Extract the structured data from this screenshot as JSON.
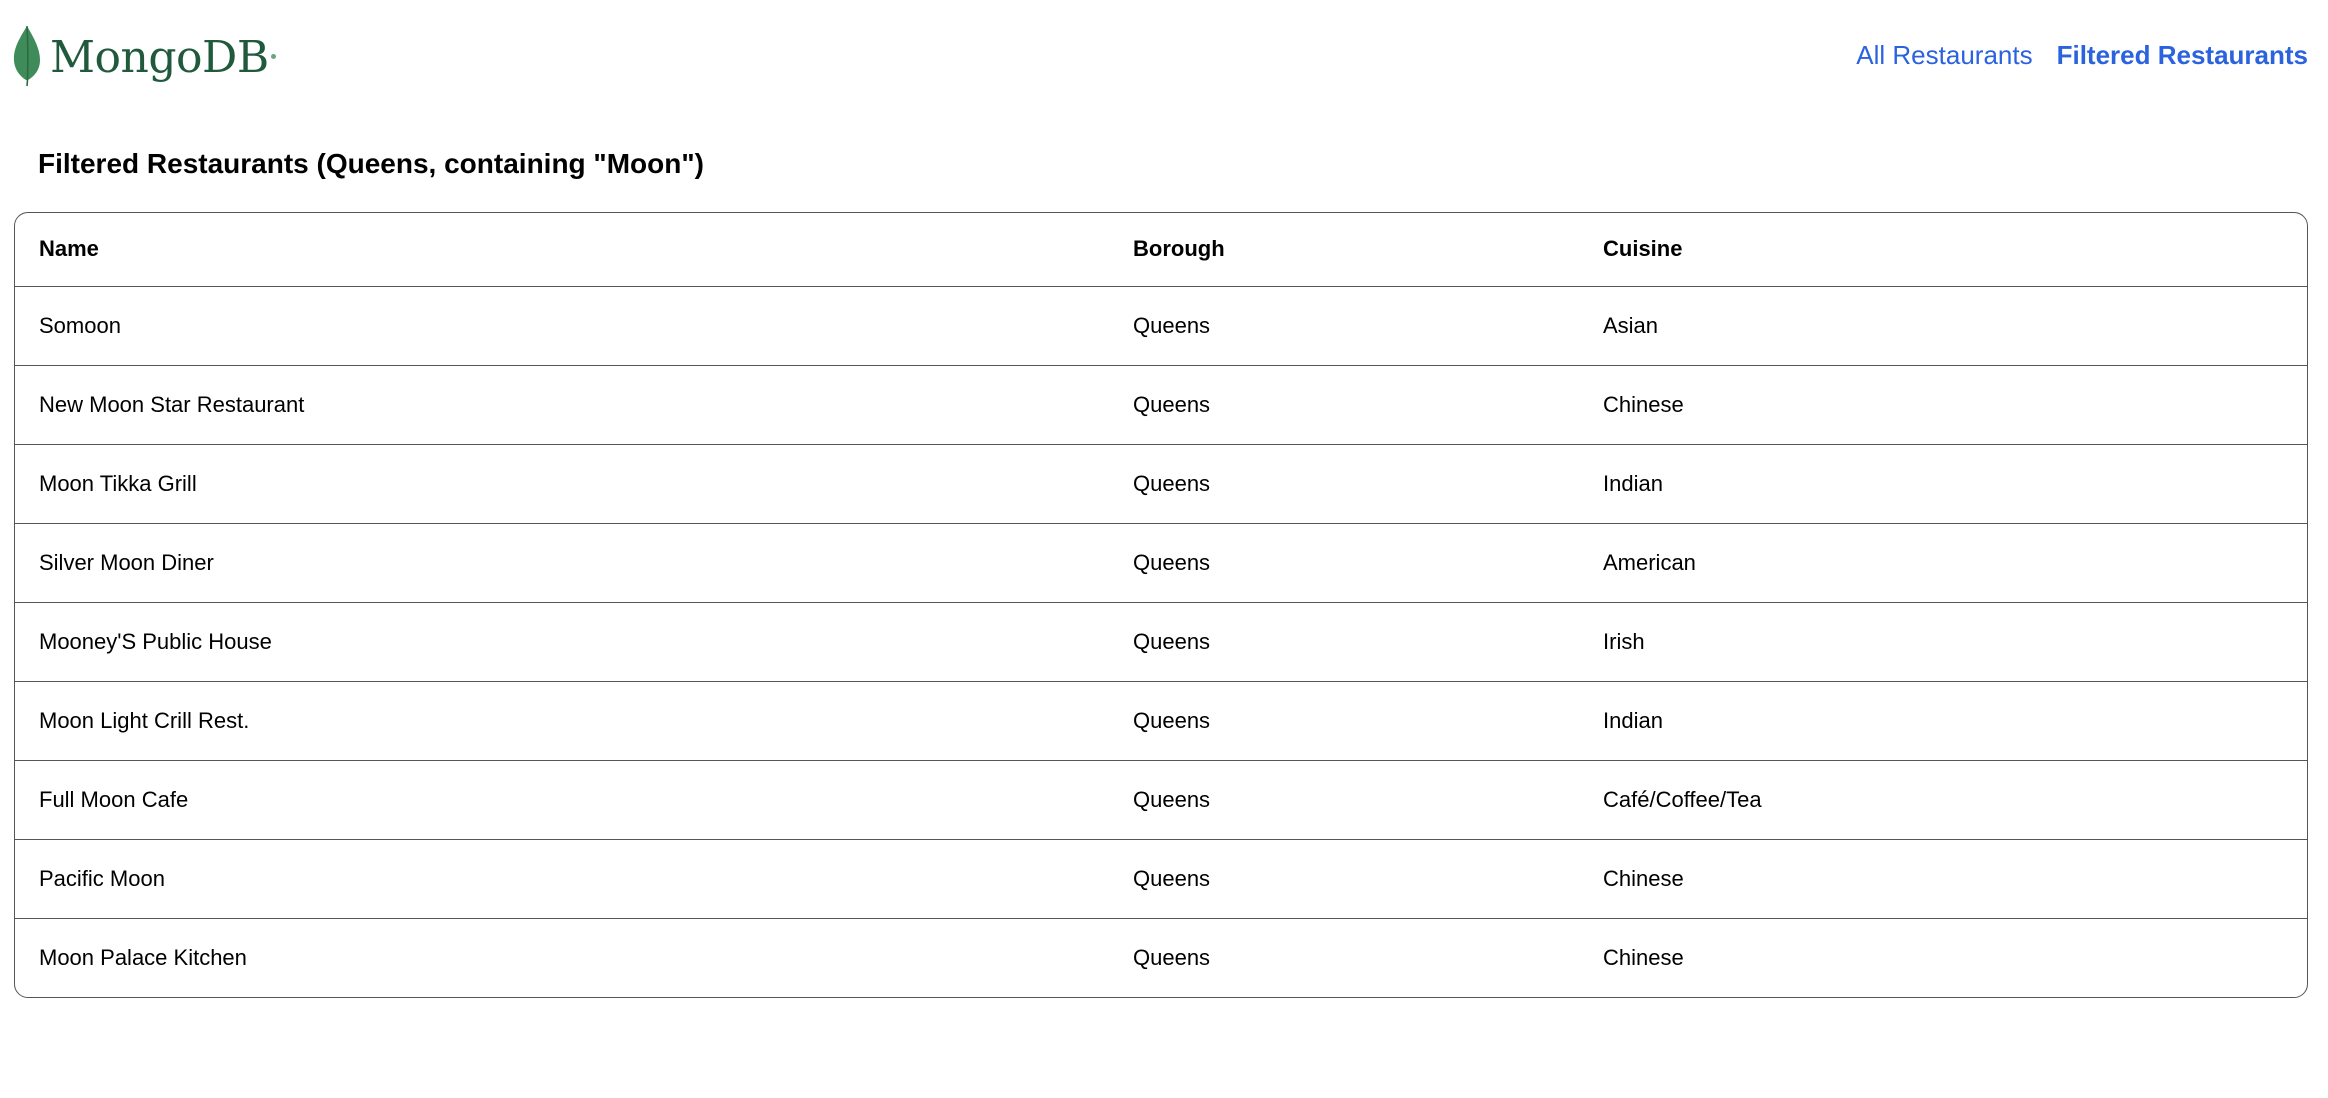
{
  "header": {
    "logo_text": "MongoDB",
    "nav": [
      {
        "label": "All Restaurants",
        "active": false
      },
      {
        "label": "Filtered Restaurants",
        "active": true
      }
    ]
  },
  "page_title": "Filtered Restaurants (Queens, containing \"Moon\")",
  "table": {
    "columns": [
      "Name",
      "Borough",
      "Cuisine"
    ],
    "rows": [
      [
        "Somoon",
        "Queens",
        "Asian"
      ],
      [
        "New Moon Star Restaurant",
        "Queens",
        "Chinese"
      ],
      [
        "Moon Tikka Grill",
        "Queens",
        "Indian"
      ],
      [
        "Silver Moon Diner",
        "Queens",
        "American"
      ],
      [
        "Mooney'S Public House",
        "Queens",
        "Irish"
      ],
      [
        "Moon Light Crill Rest.",
        "Queens",
        "Indian"
      ],
      [
        "Full Moon Cafe",
        "Queens",
        "Café/Coffee/Tea"
      ],
      [
        "Pacific Moon",
        "Queens",
        "Chinese"
      ],
      [
        "Moon Palace Kitchen",
        "Queens",
        "Chinese"
      ]
    ]
  },
  "colors": {
    "brand_green": "#21593d",
    "leaf_green": "#3f8b5a",
    "link_blue": "#2b62de",
    "border": "#555555"
  },
  "icons": {
    "logo": "mongodb-leaf-icon"
  }
}
